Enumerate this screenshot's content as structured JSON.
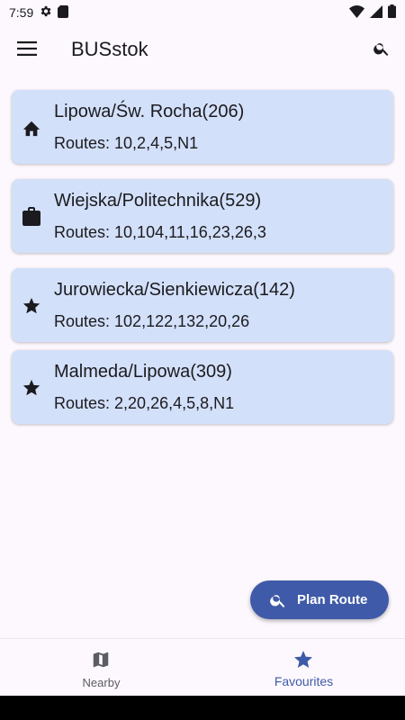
{
  "status_bar": {
    "time": "7:59",
    "icons": [
      "gear-icon",
      "sd-card-icon",
      "wifi-icon",
      "signal-icon",
      "battery-icon"
    ]
  },
  "app_bar": {
    "title": "BUSstok",
    "menu_icon": "menu-icon",
    "search_icon": "search-icon"
  },
  "stops": [
    {
      "icon": "home-icon",
      "name": "Lipowa/Św. Rocha(206)",
      "routes": "Routes: 10,2,4,5,N1"
    },
    {
      "icon": "briefcase-icon",
      "name": "Wiejska/Politechnika(529)",
      "routes": "Routes: 10,104,11,16,23,26,3"
    },
    {
      "icon": "star-icon",
      "name": "Jurowiecka/Sienkiewicza(142)",
      "routes": "Routes: 102,122,132,20,26"
    },
    {
      "icon": "star-icon",
      "name": "Malmeda/Lipowa(309)",
      "routes": "Routes: 2,20,26,4,5,8,N1"
    }
  ],
  "fab": {
    "label": "Plan Route",
    "icon": "search-icon"
  },
  "bottom_nav": {
    "items": [
      {
        "label": "Nearby",
        "icon": "map-icon",
        "selected": false
      },
      {
        "label": "Favourites",
        "icon": "star-icon",
        "selected": true
      }
    ]
  },
  "colors": {
    "card_bg": "#d3e0fa",
    "accent": "#3f5aa8",
    "background": "#fdf8fd"
  }
}
